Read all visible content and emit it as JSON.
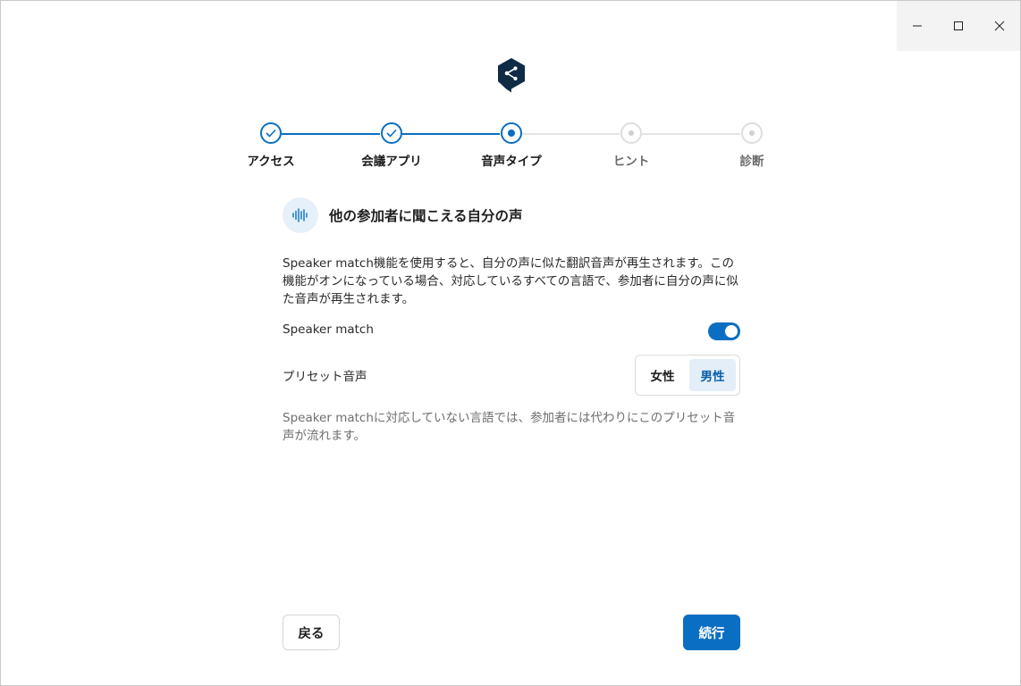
{
  "window": {
    "controls": [
      "minimize",
      "maximize",
      "close"
    ]
  },
  "brand": {
    "logo_icon": "deepl-logo-icon",
    "logo_color": "#0f2b46"
  },
  "stepper": {
    "steps": [
      {
        "label": "アクセス",
        "state": "done"
      },
      {
        "label": "会議アプリ",
        "state": "done"
      },
      {
        "label": "音声タイプ",
        "state": "active"
      },
      {
        "label": "ヒント",
        "state": "pending"
      },
      {
        "label": "診断",
        "state": "pending"
      }
    ],
    "accent": "#0a6fc2"
  },
  "section": {
    "icon": "soundwave-icon",
    "title": "他の参加者に聞こえる自分の声",
    "description": "Speaker match機能を使用すると、自分の声に似た翻訳音声が再生されます。この機能がオンになっている場合、対応しているすべての言語で、参加者に自分の声に似た音声が再生されます。"
  },
  "speaker_match": {
    "label": "Speaker match",
    "enabled": true
  },
  "preset_voice": {
    "label": "プリセット音声",
    "options": [
      "女性",
      "男性"
    ],
    "selected": "男性"
  },
  "note": "Speaker matchに対応していない言語では、参加者には代わりにこのプリセット音声が流れます。",
  "footer": {
    "back_label": "戻る",
    "next_label": "続行"
  }
}
